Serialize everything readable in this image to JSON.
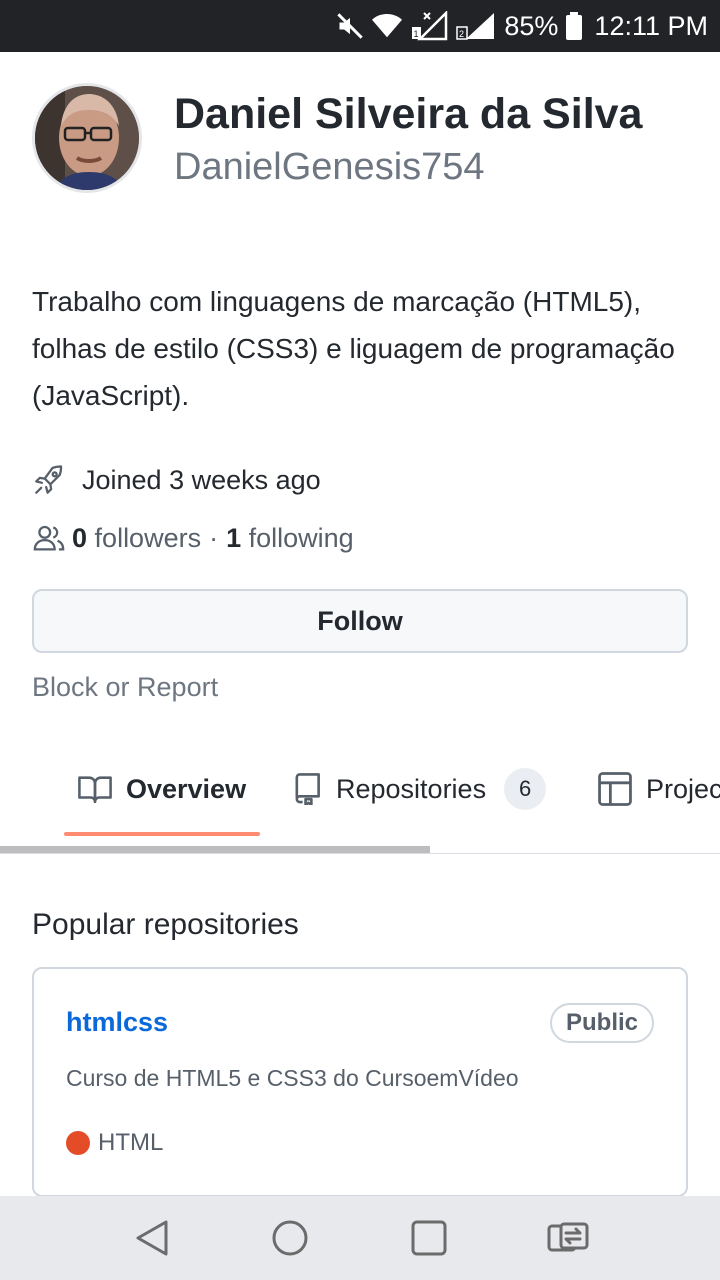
{
  "status_bar": {
    "battery": "85%",
    "time": "12:11 PM"
  },
  "profile": {
    "name": "Daniel Silveira da Silva",
    "login": "DanielGenesis754",
    "bio": "Trabalho com linguagens de marcação (HTML5), folhas de estilo (CSS3) e liguagem de programação (JavaScript).",
    "joined": "Joined 3 weeks ago",
    "followers_count": "0",
    "followers_label": "followers",
    "separator": "·",
    "following_count": "1",
    "following_label": "following",
    "follow_button": "Follow",
    "block_link": "Block or Report"
  },
  "tabs": [
    {
      "label": "Overview",
      "icon": "book-icon"
    },
    {
      "label": "Repositories",
      "icon": "repo-icon",
      "counter": "6"
    },
    {
      "label": "Projects",
      "icon": "table-icon"
    }
  ],
  "popular": {
    "title": "Popular repositories",
    "repos": [
      {
        "name": "htmlcss",
        "visibility": "Public",
        "description": "Curso de HTML5 e CSS3 do CursoemVídeo",
        "language": "HTML",
        "language_color": "#e34c26"
      }
    ]
  },
  "colors": {
    "link": "#0969da",
    "tab_underline": "#fd8c73",
    "status_bar": "#222326"
  }
}
